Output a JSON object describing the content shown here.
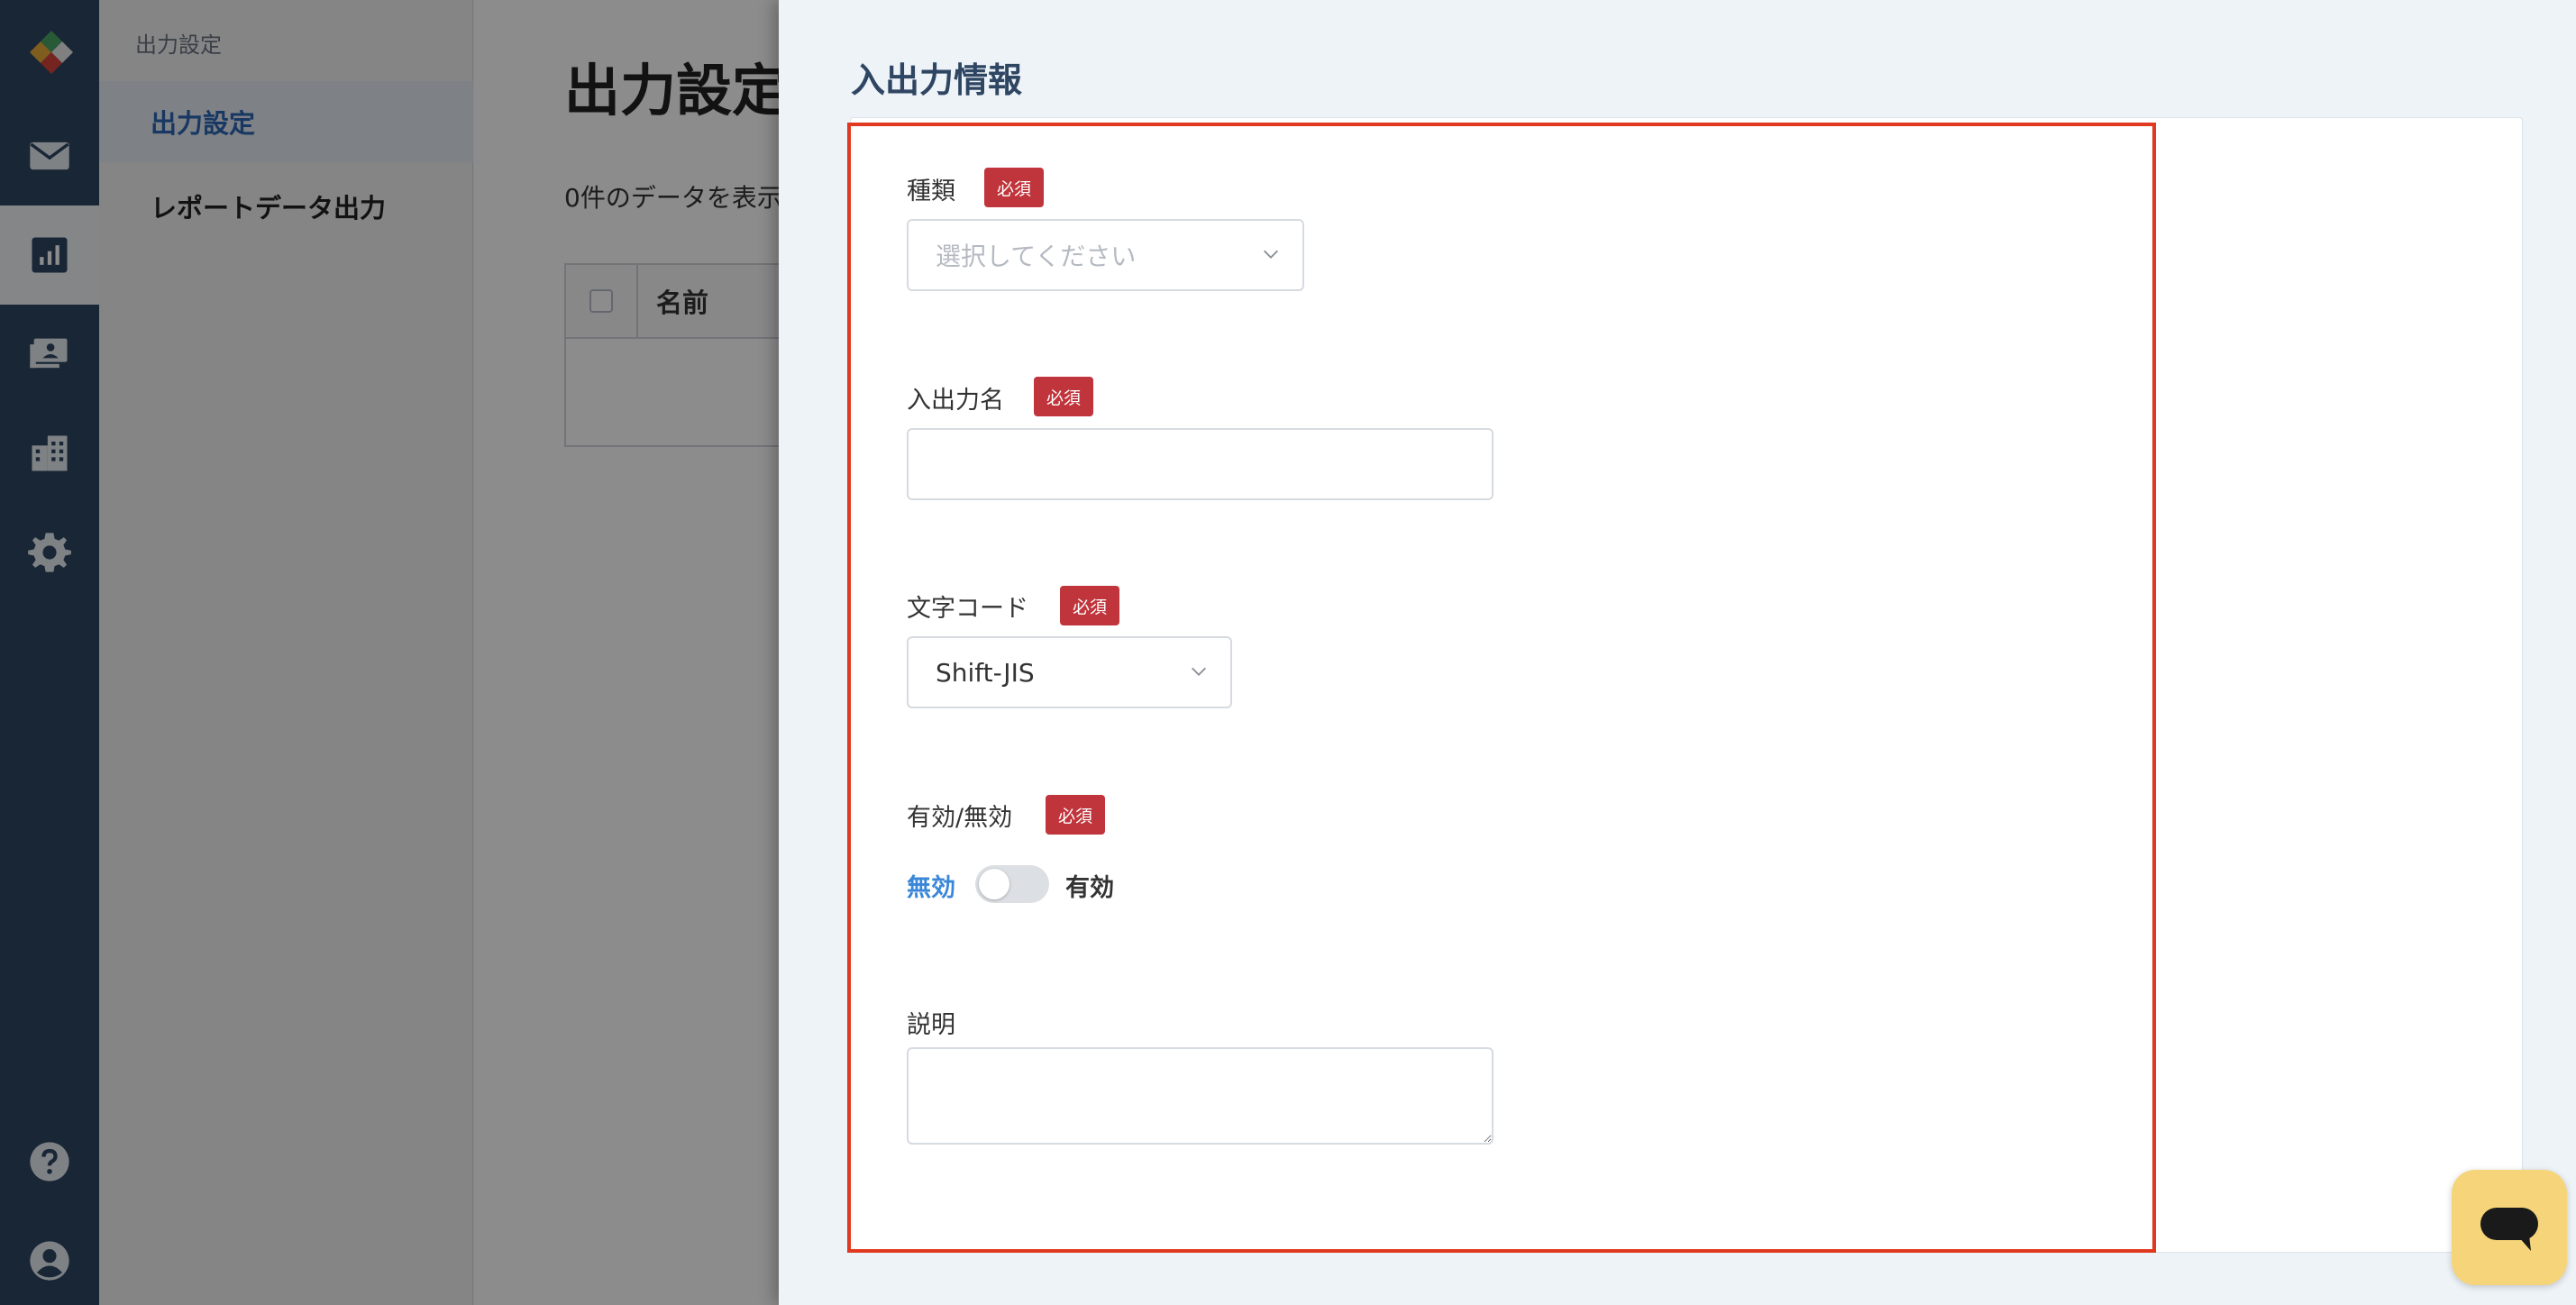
{
  "colors": {
    "rail_bg": "#2f4663",
    "accent": "#2d67b4",
    "required_badge": "#c0343b",
    "highlight_border": "#e0391f",
    "toggle_off_text": "#3a86d8",
    "chat_button": "#f6d57a"
  },
  "rail": {
    "items": [
      {
        "icon": "mail-icon"
      },
      {
        "icon": "chart-icon",
        "active": true
      },
      {
        "icon": "monitor-icon"
      },
      {
        "icon": "building-icon"
      },
      {
        "icon": "gear-icon"
      },
      {
        "icon": "help-icon"
      },
      {
        "icon": "user-icon"
      }
    ]
  },
  "subnav": {
    "heading": "出力設定",
    "items": [
      {
        "label": "出力設定",
        "active": true
      },
      {
        "label": "レポートデータ出力"
      }
    ]
  },
  "main": {
    "title": "出力設定",
    "result_count": "0件のデータを表示",
    "table": {
      "columns": [
        "名前"
      ]
    }
  },
  "drawer": {
    "title": "入出力情報",
    "required_badge": "必須",
    "fields": {
      "type": {
        "label": "種類",
        "placeholder": "選択してください",
        "value": ""
      },
      "name": {
        "label": "入出力名",
        "value": ""
      },
      "encoding": {
        "label": "文字コード",
        "value": "Shift-JIS"
      },
      "enabled": {
        "label": "有効/無効",
        "off_label": "無効",
        "on_label": "有効",
        "state": "off"
      },
      "description": {
        "label": "説明",
        "value": ""
      }
    }
  },
  "chat": {
    "icon": "chat-icon"
  }
}
